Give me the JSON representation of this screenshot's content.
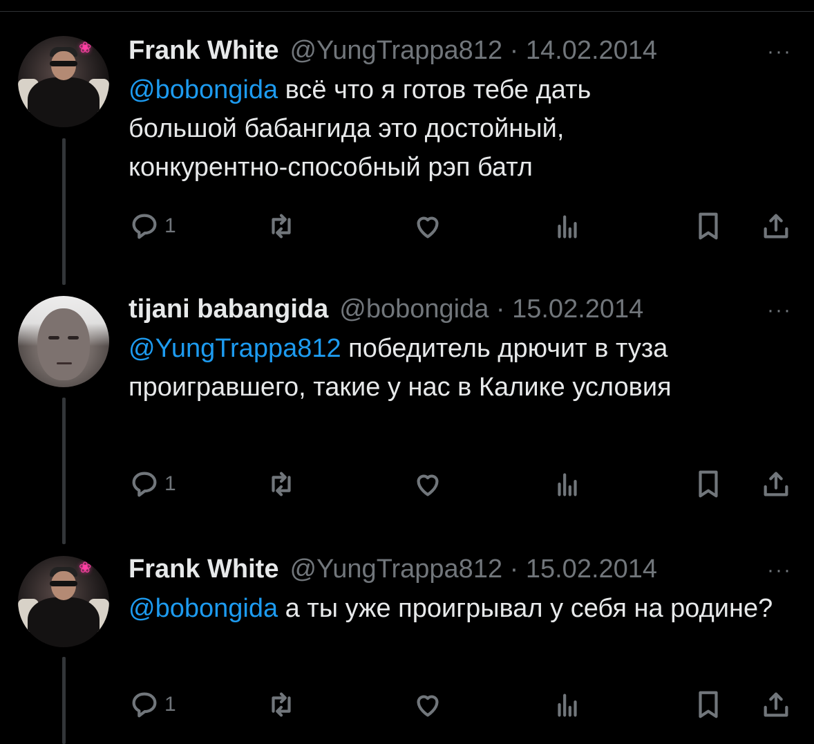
{
  "tweets": [
    {
      "author": "Frank White",
      "handle_date": "@YungTrappa812 · 14.02.2014",
      "mention": "@bobongida",
      "text": " всё что я готов тебе дать большой бабангида это достойный, конкурентно-способный рэп батл",
      "reply_count": "1"
    },
    {
      "author": "tijani babangida",
      "handle_date": "@bobongida · 15.02.2014",
      "mention": "@YungTrappa812",
      "text": " победитель дрючит в туза проигравшего, такие у нас в Калике условия",
      "reply_count": "1"
    },
    {
      "author": "Frank White",
      "handle_date": "@YungTrappa812 · 15.02.2014",
      "mention": "@bobongida",
      "text": " а ты уже проигрывал у себя на родине?",
      "reply_count": "1"
    }
  ],
  "more_label": "···",
  "icons": [
    "reply-icon",
    "retweet-icon",
    "like-icon",
    "views-icon",
    "bookmark-icon",
    "share-icon"
  ]
}
